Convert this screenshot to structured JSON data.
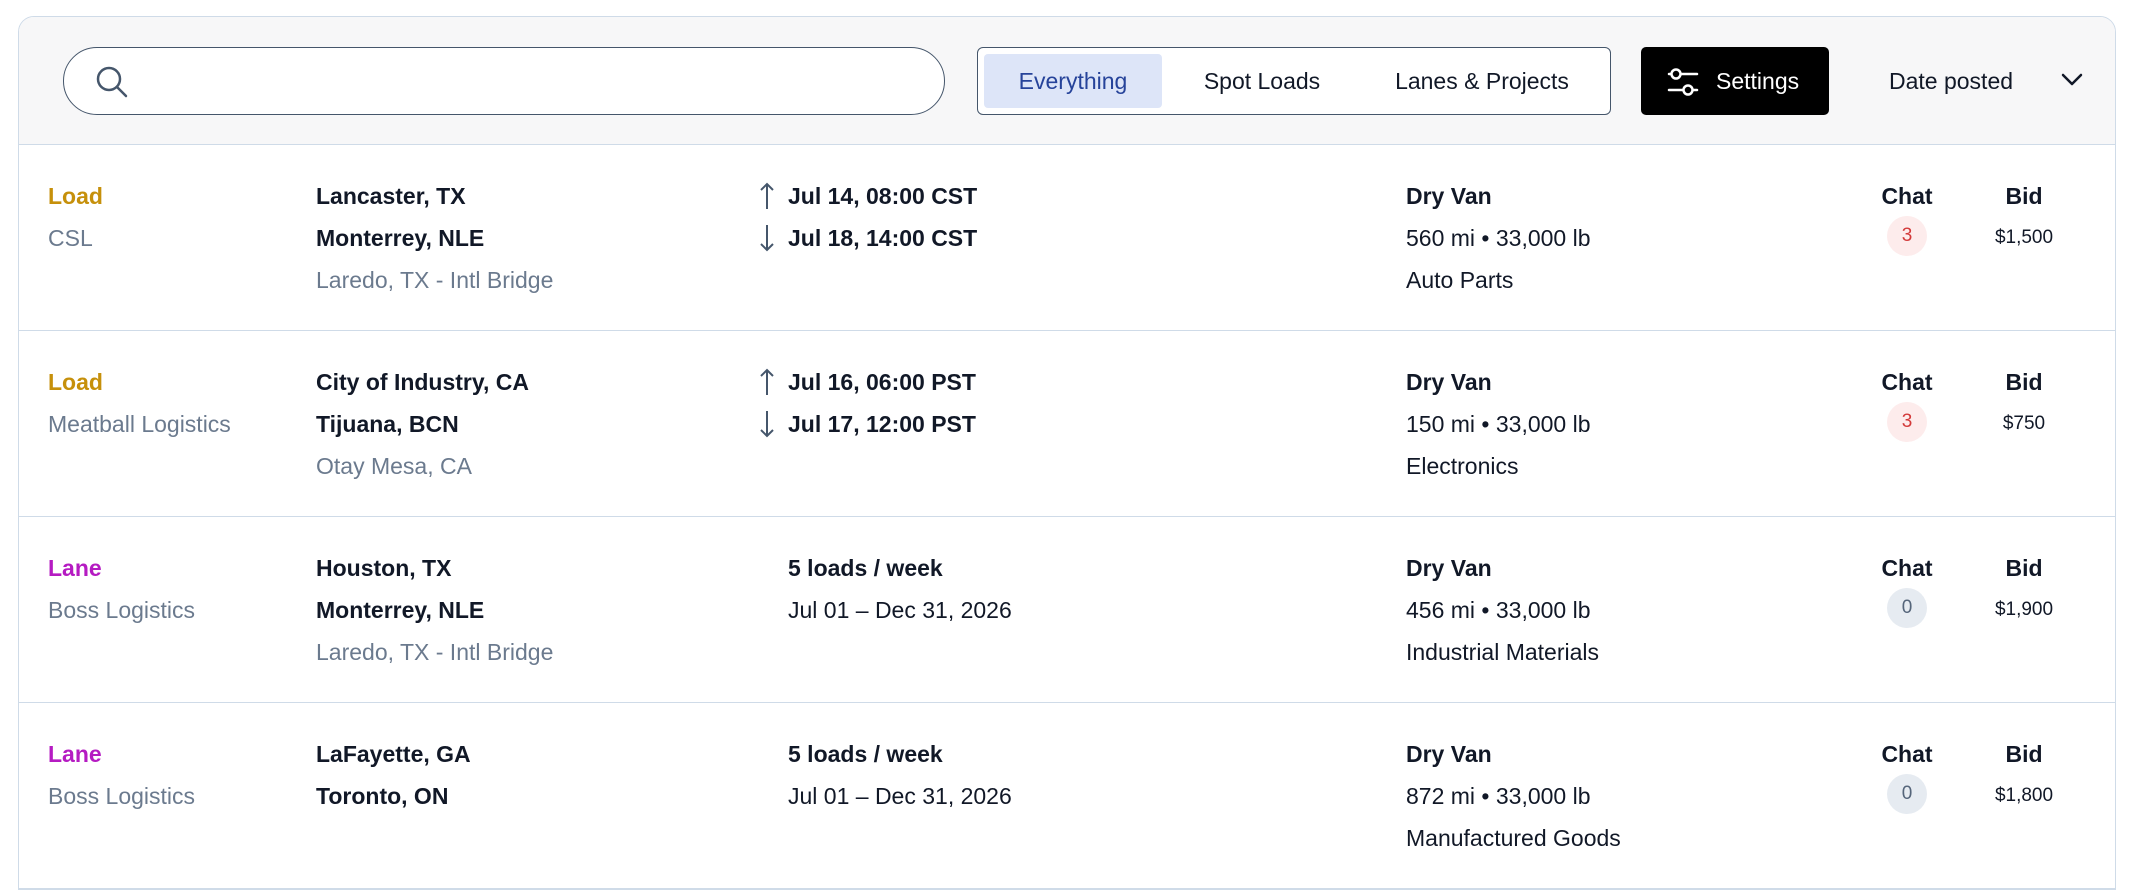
{
  "search": {
    "value": "",
    "placeholder": ""
  },
  "filters": {
    "tabs": [
      {
        "label": "Everything",
        "active": true
      },
      {
        "label": "Spot Loads",
        "active": false
      },
      {
        "label": "Lanes & Projects",
        "active": false
      }
    ]
  },
  "toolbar": {
    "settings_label": "Settings",
    "sort_label": "Date posted"
  },
  "columns": {
    "chat": "Chat",
    "bid": "Bid"
  },
  "colors": {
    "load": "#c6900b",
    "lane": "#b51bc2",
    "active_tab_bg": "#dde5f8",
    "active_tab_text": "#26439a",
    "unread_badge": "#d33a3a"
  },
  "rows": [
    {
      "kind": "Load",
      "company": "CSL",
      "origin": "Lancaster, TX",
      "destination": "Monterrey, NLE",
      "via": "Laredo, TX - Intl Bridge",
      "pickup": "Jul 14, 08:00 CST",
      "delivery": "Jul 18, 14:00 CST",
      "equipment": "Dry Van",
      "stats": "560 mi • 33,000 lb",
      "commodity": "Auto Parts",
      "chat_count": "3",
      "bid": "$1,500"
    },
    {
      "kind": "Load",
      "company": "Meatball Logistics",
      "origin": "City of Industry, CA",
      "destination": "Tijuana, BCN",
      "via": "Otay Mesa, CA",
      "pickup": "Jul 16, 06:00 PST",
      "delivery": "Jul 17, 12:00 PST",
      "equipment": "Dry Van",
      "stats": "150 mi • 33,000 lb",
      "commodity": "Electronics",
      "chat_count": "3",
      "bid": "$750"
    },
    {
      "kind": "Lane",
      "company": "Boss Logistics",
      "origin": "Houston, TX",
      "destination": "Monterrey, NLE",
      "via": "Laredo, TX - Intl Bridge",
      "frequency": "5 loads / week",
      "date_range": "Jul 01 – Dec 31, 2026",
      "equipment": "Dry Van",
      "stats": "456 mi • 33,000 lb",
      "commodity": "Industrial Materials",
      "chat_count": "0",
      "bid": "$1,900"
    },
    {
      "kind": "Lane",
      "company": "Boss Logistics",
      "origin": "LaFayette, GA",
      "destination": "Toronto, ON",
      "frequency": "5 loads / week",
      "date_range": "Jul 01 – Dec 31, 2026",
      "equipment": "Dry Van",
      "stats": "872 mi • 33,000 lb",
      "commodity": "Manufactured Goods",
      "chat_count": "0",
      "bid": "$1,800"
    }
  ]
}
